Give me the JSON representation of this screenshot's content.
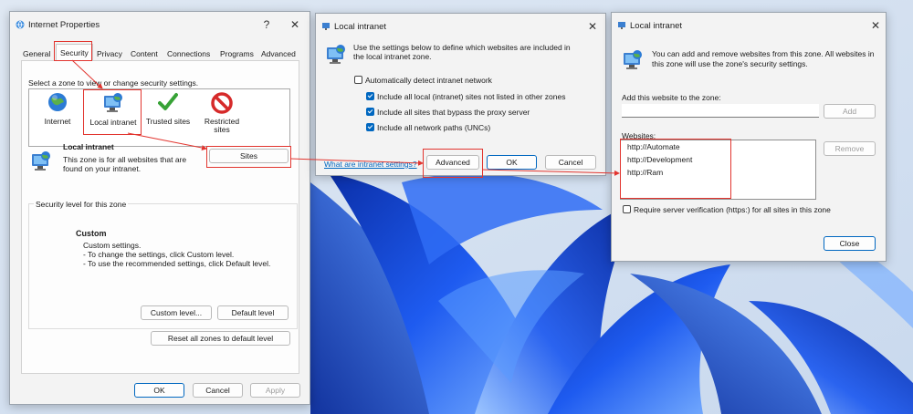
{
  "ip": {
    "title": "Internet Properties",
    "help_label": "?",
    "close_label": "✕",
    "tabs": [
      "General",
      "Security",
      "Privacy",
      "Content",
      "Connections",
      "Programs",
      "Advanced"
    ],
    "select_zone_text": "Select a zone to view or change security settings.",
    "zones": [
      "Internet",
      "Local intranet",
      "Trusted sites",
      "Restricted sites"
    ],
    "zone_title": "Local intranet",
    "zone_desc": "This zone is for all websites that are found on your intranet.",
    "sites_label": "Sites",
    "security_level_label": "Security level for this zone",
    "level_name": "Custom",
    "level_lines": [
      "Custom settings.",
      "- To change the settings, click Custom level.",
      "- To use the recommended settings, click Default level."
    ],
    "custom_level_label": "Custom level...",
    "default_level_label": "Default level",
    "reset_label": "Reset all zones to default level",
    "ok_label": "OK",
    "cancel_label": "Cancel",
    "apply_label": "Apply"
  },
  "li1": {
    "title": "Local intranet",
    "close_label": "✕",
    "intro": "Use the settings below to define which websites are included in the local intranet zone.",
    "options": [
      {
        "label": "Automatically detect intranet network",
        "checked": false
      },
      {
        "label": "Include all local (intranet) sites not listed in other zones",
        "checked": true
      },
      {
        "label": "Include all sites that bypass the proxy server",
        "checked": true
      },
      {
        "label": "Include all network paths (UNCs)",
        "checked": true
      }
    ],
    "link_text": "What are intranet settings?",
    "advanced_label": "Advanced",
    "ok_label": "OK",
    "cancel_label": "Cancel"
  },
  "li2": {
    "title": "Local intranet",
    "close_label": "✕",
    "intro": "You can add and remove websites from this zone. All websites in this zone will use the zone's security settings.",
    "add_label_text": "Add this website to the zone:",
    "add_input_value": "",
    "add_button_label": "Add",
    "websites_label": "Websites:",
    "websites": [
      "http://Automate",
      "http://Development",
      "http://Ram"
    ],
    "remove_label": "Remove",
    "require_label": "Require server verification (https:) for all sites in this zone",
    "require_checked": false,
    "close_button_label": "Close"
  },
  "colors": {
    "accent": "#0067c0",
    "annotation": "#e2352f",
    "wallpaper": "#1e4fd8"
  }
}
